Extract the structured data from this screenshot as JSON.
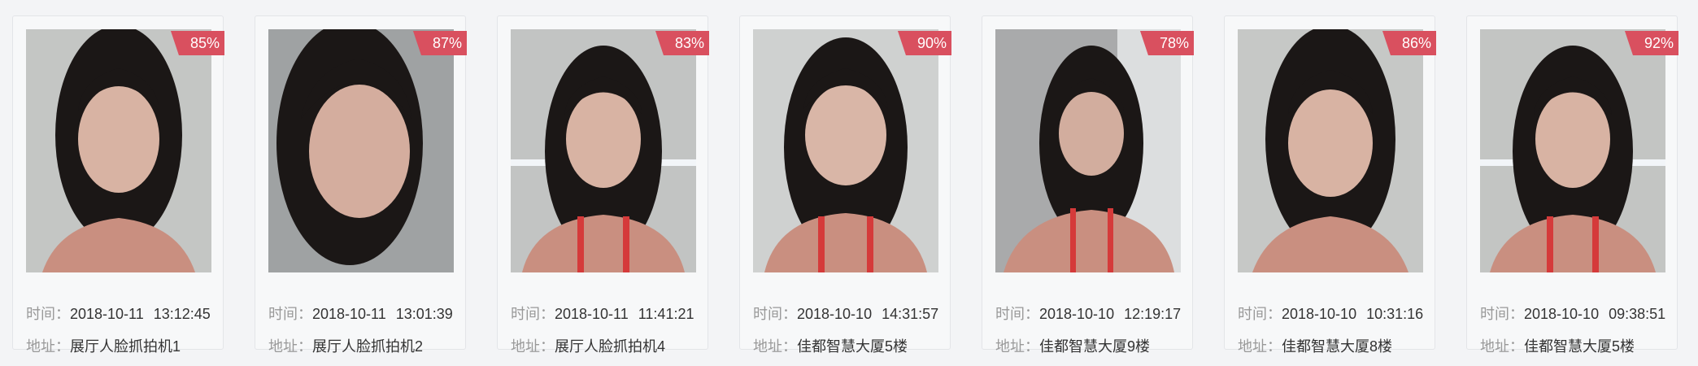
{
  "captures": [
    {
      "score": "85%",
      "time_label": "时间：",
      "date": "2018-10-11",
      "time": "13:12:45",
      "addr_label": "地址：",
      "address": "展厅人脸抓拍机1",
      "bg": "#c4c6c4"
    },
    {
      "score": "87%",
      "time_label": "时间：",
      "date": "2018-10-11",
      "time": "13:01:39",
      "addr_label": "地址：",
      "address": "展厅人脸抓拍机2",
      "bg": "#9fa2a3"
    },
    {
      "score": "83%",
      "time_label": "时间：",
      "date": "2018-10-11",
      "time": "11:41:21",
      "addr_label": "地址：",
      "address": "展厅人脸抓拍机4",
      "bg": "#c2c4c3"
    },
    {
      "score": "90%",
      "time_label": "时间：",
      "date": "2018-10-10",
      "time": "14:31:57",
      "addr_label": "地址：",
      "address": "佳都智慧大厦5楼",
      "bg": "#cfd1d0"
    },
    {
      "score": "78%",
      "time_label": "时间：",
      "date": "2018-10-10",
      "time": "12:19:17",
      "addr_label": "地址：",
      "address": "佳都智慧大厦9楼",
      "bg": "#a9aaab"
    },
    {
      "score": "86%",
      "time_label": "时间：",
      "date": "2018-10-10",
      "time": "10:31:16",
      "addr_label": "地址：",
      "address": "佳都智慧大厦8楼",
      "bg": "#c6c8c6"
    },
    {
      "score": "92%",
      "time_label": "时间：",
      "date": "2018-10-10",
      "time": "09:38:51",
      "addr_label": "地址：",
      "address": "佳都智慧大厦5楼",
      "bg": "#c3c5c3"
    }
  ],
  "colors": {
    "score_badge": "#d9505f",
    "label_text": "#999999",
    "value_text": "#333333",
    "card_bg": "#f7f8f9",
    "page_bg": "#f3f4f6"
  }
}
